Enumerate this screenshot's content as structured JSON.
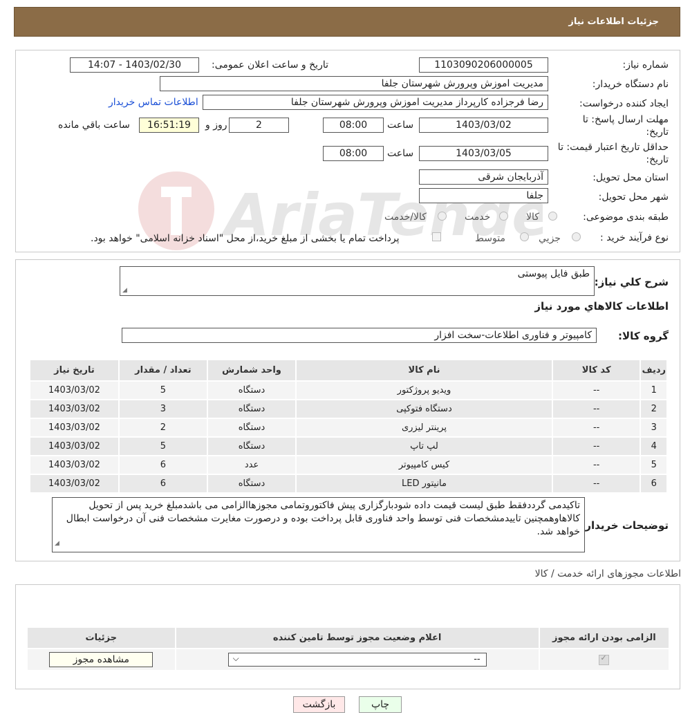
{
  "header": {
    "title": "جزئیات اطلاعات نیاز"
  },
  "form": {
    "need_number_label": "شماره نیاز:",
    "need_number": "1103090206000005",
    "announce_label": "تاریخ و ساعت اعلان عمومی:",
    "announce_value": "1403/02/30 - 14:07",
    "buyer_org_label": "نام دستگاه خریدار:",
    "buyer_org": "مدیریت اموزش وپرورش شهرستان جلفا",
    "creator_label": "ایجاد کننده درخواست:",
    "creator": "رضا فرجزاده کارپرداز مدیریت اموزش وپرورش شهرستان جلفا",
    "contact_link": "اطلاعات تماس خریدار",
    "deadline_label_1": "مهلت ارسال پاسخ: تا",
    "deadline_label_2": "تاریخ:",
    "deadline_date": "1403/03/02",
    "time_label": "ساعت",
    "deadline_time": "08:00",
    "days_value": "2",
    "days_label": "روز و",
    "remaining_time": "16:51:19",
    "remaining_label": "ساعت باقي مانده",
    "validity_label_1": "حداقل تاریخ اعتبار قیمت: تا",
    "validity_label_2": "تاریخ:",
    "validity_date": "1403/03/05",
    "validity_time": "08:00",
    "province_label": "استان محل تحویل:",
    "province": "آذربایجان شرقی",
    "city_label": "شهر محل تحویل:",
    "city": "جلفا",
    "category_label": "طبقه بندی موضوعی:",
    "category_options": [
      "کالا",
      "خدمت",
      "کالا/خدمت"
    ],
    "purchase_type_label": "نوع فرآیند خرید :",
    "purchase_type_options": [
      "جزیي",
      "متوسط"
    ],
    "payment_note": "پرداخت تمام یا بخشی از مبلغ خرید،از محل \"اسناد خزانه اسلامی\" خواهد بود."
  },
  "watermark": {
    "text": "AriaTender.neT"
  },
  "summary": {
    "label": "شرح كلي نياز:",
    "value": "طبق فایل پیوستی",
    "goods_info_title": "اطلاعات كالاهاي مورد نياز",
    "group_label": "گروه کالا:",
    "group_value": "کامپیوتر و فناوری اطلاعات-سخت افزار"
  },
  "goods_table": {
    "headers": [
      "ردیف",
      "کد کالا",
      "نام کالا",
      "واحد شمارش",
      "تعداد / مقدار",
      "تاریخ نیاز"
    ],
    "rows": [
      [
        "1",
        "--",
        "ویدیو پروژکتور",
        "دستگاه",
        "5",
        "1403/03/02"
      ],
      [
        "2",
        "--",
        "دستگاه فتوکپی",
        "دستگاه",
        "3",
        "1403/03/02"
      ],
      [
        "3",
        "--",
        "پرینتر لیزری",
        "دستگاه",
        "2",
        "1403/03/02"
      ],
      [
        "4",
        "--",
        "لپ تاپ",
        "دستگاه",
        "5",
        "1403/03/02"
      ],
      [
        "5",
        "--",
        "کیس کامپیوتر",
        "عدد",
        "6",
        "1403/03/02"
      ],
      [
        "6",
        "--",
        "مانیتور LED",
        "دستگاه",
        "6",
        "1403/03/02"
      ]
    ]
  },
  "buyer_notes": {
    "label": "توضیحات خریدار:",
    "text": "تاکیدمی گرددفقط طبق لیست قیمت داده شودبارگزاری پیش فاکتوروتمامی مجوزهاالزامی می باشدمبلغ خرید پس از تحویل کالاهاوهمچنین تاییدمشخصات فنی توسط واحد فناوری قابل پرداخت بوده و درصورت مغایرت مشخصات فنی آن درخواست ابطال خواهد شد."
  },
  "licenses": {
    "section_title": "اطلاعات مجوزهای ارائه خدمت / کالا",
    "headers": [
      "الزامی بودن ارائه مجوز",
      "اعلام وضعیت مجوز توسط تامین کننده",
      "جزئیات"
    ],
    "select_value": "--",
    "view_button": "مشاهده مجوز"
  },
  "footer": {
    "print_button": "چاپ",
    "back_button": "بازگشت"
  }
}
